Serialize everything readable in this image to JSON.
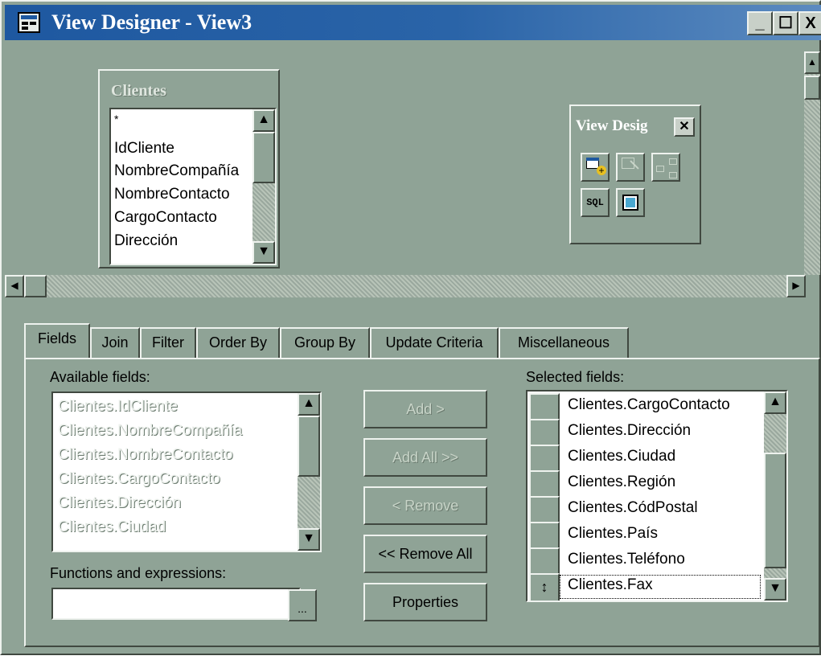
{
  "window": {
    "title": "View Designer - View3",
    "buttons": {
      "minimize": "_",
      "maximize": "☐",
      "close": "X"
    }
  },
  "table_box": {
    "title": "Clientes",
    "fields": [
      "*",
      "IdCliente",
      "NombreCompañía",
      "NombreContacto",
      "CargoContacto",
      "Dirección"
    ]
  },
  "toolbar": {
    "title": "View Desig",
    "close": "✕",
    "sql_label": "SQL"
  },
  "tabs": [
    "Fields",
    "Join",
    "Filter",
    "Order By",
    "Group By",
    "Update Criteria",
    "Miscellaneous"
  ],
  "available": {
    "label": "Available fields:",
    "items": [
      "Clientes.IdCliente",
      "Clientes.NombreCompañía",
      "Clientes.NombreContacto",
      "Clientes.CargoContacto",
      "Clientes.Dirección",
      "Clientes.Ciudad"
    ]
  },
  "functions": {
    "label": "Functions and expressions:",
    "value": "",
    "browse_label": "..."
  },
  "buttons": {
    "add": "Add >",
    "add_all": "Add All >>",
    "remove": "< Remove",
    "remove_all": "<< Remove All",
    "properties": "Properties"
  },
  "selected": {
    "label": "Selected fields:",
    "items": [
      "Clientes.CargoContacto",
      "Clientes.Dirección",
      "Clientes.Ciudad",
      "Clientes.Región",
      "Clientes.CódPostal",
      "Clientes.País",
      "Clientes.Teléfono",
      "Clientes.Fax"
    ],
    "mover_glyph": "↕"
  }
}
